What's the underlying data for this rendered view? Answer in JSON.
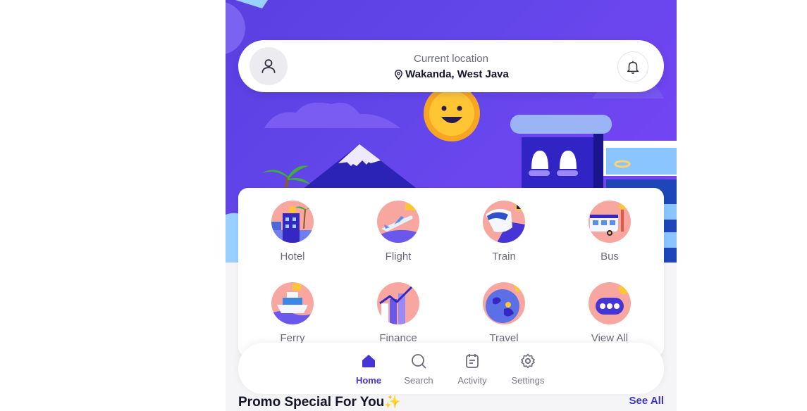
{
  "header": {
    "location_label": "Current location",
    "location_value": "Wakanda, West Java"
  },
  "icons": {
    "avatar": "user-icon",
    "pin": "location-pin-icon",
    "bell": "bell-icon"
  },
  "services": [
    {
      "label": "Hotel",
      "icon": "hotel-icon"
    },
    {
      "label": "Flight",
      "icon": "flight-icon"
    },
    {
      "label": "Train",
      "icon": "train-icon"
    },
    {
      "label": "Bus",
      "icon": "bus-icon"
    },
    {
      "label": "Ferry",
      "icon": "ferry-icon"
    },
    {
      "label": "Finance",
      "icon": "finance-icon"
    },
    {
      "label": "Travel",
      "icon": "travel-icon"
    },
    {
      "label": "View All",
      "icon": "view-all-icon"
    }
  ],
  "nav": [
    {
      "label": "Home",
      "icon": "home-icon",
      "active": true
    },
    {
      "label": "Search",
      "icon": "search-icon",
      "active": false
    },
    {
      "label": "Activity",
      "icon": "activity-icon",
      "active": false
    },
    {
      "label": "Settings",
      "icon": "gear-icon",
      "active": false
    }
  ],
  "promo": {
    "title": "Promo Special For You",
    "see_all": "See All"
  },
  "colors": {
    "brand": "#6246ea",
    "accent": "#3b34c9",
    "icon_bg": "#f7a7a0"
  }
}
